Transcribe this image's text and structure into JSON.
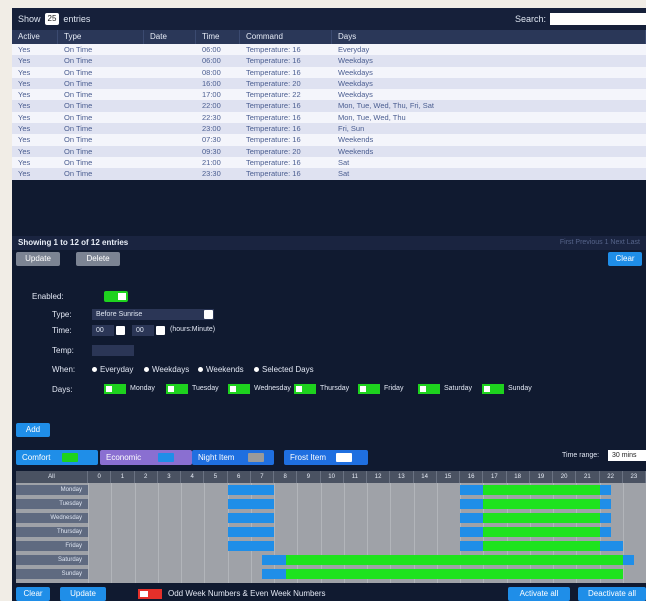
{
  "toolbar": {
    "show_label": "Show",
    "entries_value": "25",
    "entries_label": "entries",
    "search_label": "Search:"
  },
  "table": {
    "columns": [
      "Active",
      "Type",
      "Date",
      "Time",
      "Command",
      "Days"
    ],
    "rows": [
      [
        "Yes",
        "On Time",
        "",
        "06:00",
        "Temperature: 16",
        "Everyday"
      ],
      [
        "Yes",
        "On Time",
        "",
        "06:00",
        "Temperature: 16",
        "Weekdays"
      ],
      [
        "Yes",
        "On Time",
        "",
        "08:00",
        "Temperature: 16",
        "Weekdays"
      ],
      [
        "Yes",
        "On Time",
        "",
        "16:00",
        "Temperature: 20",
        "Weekdays"
      ],
      [
        "Yes",
        "On Time",
        "",
        "17:00",
        "Temperature: 22",
        "Weekdays"
      ],
      [
        "Yes",
        "On Time",
        "",
        "22:00",
        "Temperature: 16",
        "Mon, Tue, Wed, Thu, Fri, Sat"
      ],
      [
        "Yes",
        "On Time",
        "",
        "22:30",
        "Temperature: 16",
        "Mon, Tue, Wed, Thu"
      ],
      [
        "Yes",
        "On Time",
        "",
        "23:00",
        "Temperature: 16",
        "Fri, Sun"
      ],
      [
        "Yes",
        "On Time",
        "",
        "07:30",
        "Temperature: 16",
        "Weekends"
      ],
      [
        "Yes",
        "On Time",
        "",
        "09:30",
        "Temperature: 20",
        "Weekends"
      ],
      [
        "Yes",
        "On Time",
        "",
        "21:00",
        "Temperature: 16",
        "Sat"
      ],
      [
        "Yes",
        "On Time",
        "",
        "23:30",
        "Temperature: 16",
        "Sat"
      ]
    ],
    "showing": "Showing 1 to 12 of 12 entries",
    "pager": "First  Previous  1  Next  Last"
  },
  "actions": {
    "update": "Update",
    "delete": "Delete",
    "clear": "Clear"
  },
  "form": {
    "enabled_label": "Enabled:",
    "type_label": "Type:",
    "type_value": "Before Sunrise",
    "time_label": "Time:",
    "time_hour": "00",
    "time_min": "00",
    "time_hint": "(hours:Minute)",
    "temp_label": "Temp:",
    "when_label": "When:",
    "when_options": [
      "Everyday",
      "Weekdays",
      "Weekends",
      "Selected Days"
    ],
    "days_label": "Days:",
    "days": [
      "Monday",
      "Tuesday",
      "Wednesday",
      "Thursday",
      "Friday",
      "Saturday",
      "Sunday"
    ],
    "add": "Add"
  },
  "legend": {
    "comfort": "Comfort",
    "economic": "Economic",
    "night": "Night Item",
    "frost": "Frost Item",
    "time_range_label": "Time range:",
    "time_range_value": "30 mins"
  },
  "grid": {
    "corner": "All",
    "hours": [
      "0",
      "1",
      "2",
      "3",
      "4",
      "5",
      "6",
      "7",
      "8",
      "9",
      "10",
      "11",
      "12",
      "13",
      "14",
      "15",
      "16",
      "17",
      "18",
      "19",
      "20",
      "21",
      "22",
      "23"
    ],
    "days": [
      "Monday",
      "Tuesday",
      "Wednesday",
      "Thursday",
      "Friday",
      "Saturday",
      "Sunday"
    ],
    "schedule": [
      [
        {
          "from": 6,
          "to": 8,
          "c": "blue"
        },
        {
          "from": 16,
          "to": 17,
          "c": "blue"
        },
        {
          "from": 17,
          "to": 22,
          "c": "green"
        },
        {
          "from": 22,
          "to": 22.5,
          "c": "blue"
        }
      ],
      [
        {
          "from": 6,
          "to": 8,
          "c": "blue"
        },
        {
          "from": 16,
          "to": 17,
          "c": "blue"
        },
        {
          "from": 17,
          "to": 22,
          "c": "green"
        },
        {
          "from": 22,
          "to": 22.5,
          "c": "blue"
        }
      ],
      [
        {
          "from": 6,
          "to": 8,
          "c": "blue"
        },
        {
          "from": 16,
          "to": 17,
          "c": "blue"
        },
        {
          "from": 17,
          "to": 22,
          "c": "green"
        },
        {
          "from": 22,
          "to": 22.5,
          "c": "blue"
        }
      ],
      [
        {
          "from": 6,
          "to": 8,
          "c": "blue"
        },
        {
          "from": 16,
          "to": 17,
          "c": "blue"
        },
        {
          "from": 17,
          "to": 22,
          "c": "green"
        },
        {
          "from": 22,
          "to": 22.5,
          "c": "blue"
        }
      ],
      [
        {
          "from": 6,
          "to": 8,
          "c": "blue"
        },
        {
          "from": 16,
          "to": 17,
          "c": "blue"
        },
        {
          "from": 17,
          "to": 22,
          "c": "green"
        },
        {
          "from": 22,
          "to": 23,
          "c": "blue"
        }
      ],
      [
        {
          "from": 7.5,
          "to": 8.5,
          "c": "blue"
        },
        {
          "from": 8.5,
          "to": 23,
          "c": "green"
        },
        {
          "from": 23,
          "to": 23.5,
          "c": "blue"
        }
      ],
      [
        {
          "from": 7.5,
          "to": 8.5,
          "c": "blue"
        },
        {
          "from": 8.5,
          "to": 23,
          "c": "green"
        }
      ]
    ]
  },
  "bottom": {
    "clear": "Clear",
    "update": "Update",
    "weeks_label": "Odd Week Numbers & Even Week Numbers",
    "activate_all": "Activate all",
    "deactivate_all": "Deactivate all"
  }
}
